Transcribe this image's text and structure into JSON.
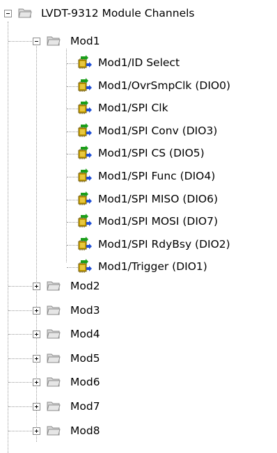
{
  "root": {
    "label": "LVDT-9312 Module Channels",
    "expanded": true,
    "icon": "folder-icon"
  },
  "mod1": {
    "label": "Mod1",
    "expanded": true,
    "icon": "folder-icon",
    "channels": [
      {
        "label": "Mod1/ID Select",
        "icon": "channel-icon"
      },
      {
        "label": "Mod1/OvrSmpClk (DIO0)",
        "icon": "channel-icon"
      },
      {
        "label": "Mod1/SPI Clk",
        "icon": "channel-icon"
      },
      {
        "label": "Mod1/SPI Conv (DIO3)",
        "icon": "channel-icon"
      },
      {
        "label": "Mod1/SPI CS (DIO5)",
        "icon": "channel-icon"
      },
      {
        "label": "Mod1/SPI Func (DIO4)",
        "icon": "channel-icon"
      },
      {
        "label": "Mod1/SPI MISO (DIO6)",
        "icon": "channel-icon"
      },
      {
        "label": "Mod1/SPI MOSI (DIO7)",
        "icon": "channel-icon"
      },
      {
        "label": "Mod1/SPI RdyBsy (DIO2)",
        "icon": "channel-icon"
      },
      {
        "label": "Mod1/Trigger (DIO1)",
        "icon": "channel-icon"
      }
    ]
  },
  "collapsed_modules": [
    {
      "label": "Mod2",
      "expanded": false,
      "icon": "folder-icon"
    },
    {
      "label": "Mod3",
      "expanded": false,
      "icon": "folder-icon"
    },
    {
      "label": "Mod4",
      "expanded": false,
      "icon": "folder-icon"
    },
    {
      "label": "Mod5",
      "expanded": false,
      "icon": "folder-icon"
    },
    {
      "label": "Mod6",
      "expanded": false,
      "icon": "folder-icon"
    },
    {
      "label": "Mod7",
      "expanded": false,
      "icon": "folder-icon"
    },
    {
      "label": "Mod8",
      "expanded": false,
      "icon": "folder-icon"
    }
  ],
  "colors": {
    "folder_body": "#d9d9d9",
    "folder_edge": "#8c8c8c",
    "connector": "#9a9a9a",
    "chip_body": "#c8a000",
    "arrow_green": "#1a9e1a",
    "arrow_blue": "#1f4fd6"
  }
}
